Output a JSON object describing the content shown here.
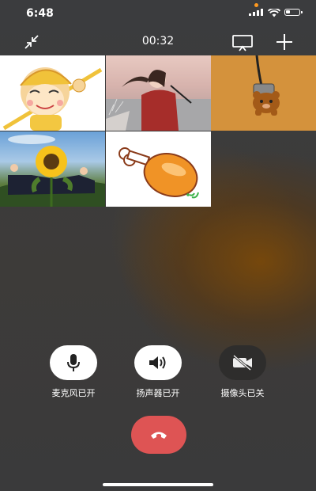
{
  "status": {
    "time": "6:48"
  },
  "call": {
    "duration": "00:32"
  },
  "topbar": {
    "minimize_icon": "minimize-arrows-icon",
    "screen_icon": "screen-share-icon",
    "add_icon": "plus-icon"
  },
  "participants": [
    {
      "name": "monkey-king-cartoon-avatar"
    },
    {
      "name": "girl-with-umbrella-photo-avatar"
    },
    {
      "name": "bear-keychain-avatar"
    },
    {
      "name": "sunflower-photo-avatar"
    },
    {
      "name": "chicken-leg-cartoon-avatar"
    }
  ],
  "controls": {
    "mic_label": "麦克风已开",
    "speaker_label": "扬声器已开",
    "camera_label": "摄像头已关"
  },
  "colors": {
    "hangup": "#de5454",
    "accent_bg": "#3a3b3d"
  }
}
